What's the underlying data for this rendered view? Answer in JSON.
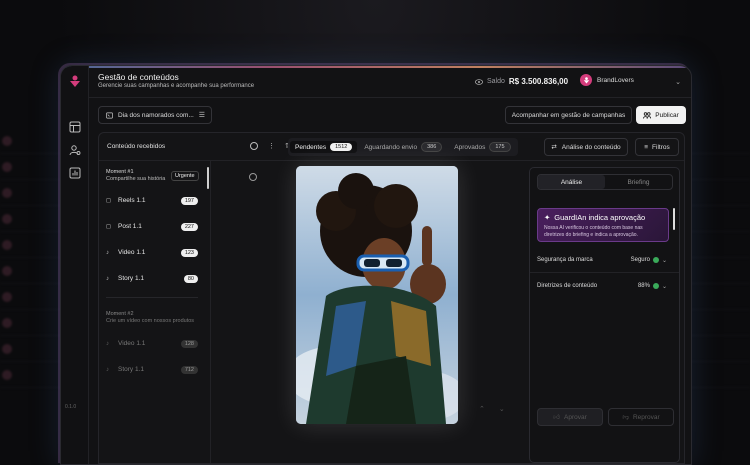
{
  "header": {
    "title": "Gestão de conteúdos",
    "subtitle": "Gerencie suas campanhas e acompanhe sua performance",
    "balance_label": "Saldo",
    "balance_value": "R$ 3.500.836,00",
    "brand_name": "BrandLovers"
  },
  "toolbar": {
    "campaign": "Dia dos namorados com...",
    "follow_label": "Acompanhar em gestão de campanhas",
    "publish_label": "Publicar"
  },
  "list_header": {
    "title": "Conteúdo recebidos",
    "tabs": [
      {
        "label": "Pendentes",
        "count": "1512"
      },
      {
        "label": "Aguardando envio",
        "count": "386"
      },
      {
        "label": "Aprovados",
        "count": "175"
      }
    ],
    "analysis_label": "Análise do conteúdo",
    "filters_label": "Filtros"
  },
  "moments": [
    {
      "title": "Moment #1",
      "subtitle": "Compartilhe sua história",
      "badge": "Urgente",
      "items": [
        {
          "icon": "instagram-icon",
          "label": "Reels 1.1",
          "count": "197"
        },
        {
          "icon": "instagram-icon",
          "label": "Post 1.1",
          "count": "227"
        },
        {
          "icon": "tiktok-icon",
          "label": "Video 1.1",
          "count": "123"
        },
        {
          "icon": "tiktok-icon",
          "label": "Story 1.1",
          "count": "80"
        }
      ]
    },
    {
      "title": "Moment #2",
      "subtitle": "Crie um vídeo com nossos produtos",
      "items": [
        {
          "icon": "tiktok-icon",
          "label": "Video 1.1",
          "count": "128"
        },
        {
          "icon": "tiktok-icon",
          "label": "Story 1.1",
          "count": "712"
        }
      ]
    }
  ],
  "panel": {
    "tabs": [
      "Análise",
      "Briefing"
    ],
    "ai_title": "GuardIAn indica aprovação",
    "ai_text": "Nossa AI verificou o conteúdo com base nas diretrizes do briefing e indica a aprovação.",
    "rows": [
      {
        "label": "Segurança da marca",
        "value": "Seguro"
      },
      {
        "label": "Diretrizes de conteúdo",
        "value": "88%"
      }
    ],
    "approve_label": "Aprovar",
    "reject_label": "Reprovar"
  },
  "version": "0.1.0",
  "colors": {
    "accent": "#d43c7c",
    "ai_bg": "#4a1f5e",
    "ok": "#3aaa5a"
  }
}
